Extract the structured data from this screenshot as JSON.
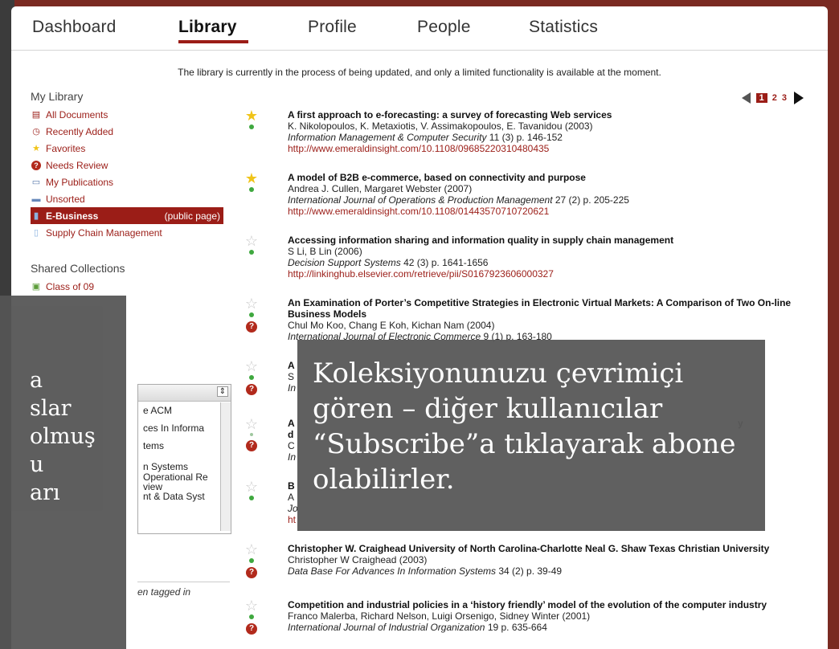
{
  "nav": {
    "tabs": [
      {
        "label": "Dashboard"
      },
      {
        "label": "Library"
      },
      {
        "label": "Profile"
      },
      {
        "label": "People"
      },
      {
        "label": "Statistics"
      }
    ],
    "active": "Library"
  },
  "notice": "The library is currently in the process of being updated, and only a limited functionality is available at the moment.",
  "sidebar": {
    "heading": "My Library",
    "items": [
      {
        "label": "All Documents",
        "icon": "documents-icon"
      },
      {
        "label": "Recently Added",
        "icon": "clock-icon"
      },
      {
        "label": "Favorites",
        "icon": "star-icon"
      },
      {
        "label": "Needs Review",
        "icon": "question-icon"
      },
      {
        "label": "My Publications",
        "icon": "id-card-icon"
      },
      {
        "label": "Unsorted",
        "icon": "tray-icon"
      },
      {
        "label": "E-Business",
        "extra": "(public page)",
        "icon": "book-icon"
      },
      {
        "label": "Supply Chain Management",
        "icon": "book-icon"
      }
    ],
    "shared_heading": "Shared Collections",
    "shared_items": [
      {
        "label": "Class of 09"
      }
    ]
  },
  "pager": {
    "current": "1",
    "pages": [
      "2",
      "3"
    ]
  },
  "documents": [
    {
      "title": "A first approach to e-forecasting: a survey of forecasting Web services",
      "authors": "K. Nikolopoulos, K. Metaxiotis, V. Assimakopoulos, E. Tavanidou (2003)",
      "journal": "Information Management & Computer Security",
      "details": " 11 (3) p. 146-152",
      "link": "http://www.emeraldinsight.com/10.1108/09685220310480435"
    },
    {
      "title": "A model of B2B e-commerce, based on connectivity and purpose",
      "authors": "Andrea J. Cullen, Margaret Webster (2007)",
      "journal": "International Journal of Operations & Production Management",
      "details": " 27 (2) p. 205-225",
      "link": "http://www.emeraldinsight.com/10.1108/01443570710720621"
    },
    {
      "title": "Accessing information sharing and information quality in supply chain management",
      "authors": "S Li, B Lin (2006)",
      "journal": "Decision Support Systems",
      "details": " 42 (3) p. 1641-1656",
      "link": "http://linkinghub.elsevier.com/retrieve/pii/S0167923606000327"
    },
    {
      "title": "An Examination of Porter’s Competitive Strategies in Electronic Virtual Markets: A Comparison of Two On-line Business Models",
      "authors": "Chul Mo Koo, Chang E Koh, Kichan Nam (2004)",
      "journal": "International Journal of Electronic Commerce",
      "details": " 9 (1) p. 163-180"
    },
    {
      "title": "A",
      "authors": "S",
      "journal": "In"
    },
    {
      "title": "A",
      "title_tail": "y",
      "title2": "d",
      "authors": "C",
      "journal": "In"
    },
    {
      "title": "B",
      "authors": "A",
      "journal": "Jo",
      "link": "ht"
    },
    {
      "title": "Christopher W. Craighead University of North Carolina-Charlotte Neal G. Shaw Texas Christian University",
      "authors": "Christopher W Craighead (2003)",
      "journal": "Data Base For Advances In Information Systems",
      "details": " 34 (2) p. 39-49"
    },
    {
      "title": "Competition and industrial policies in a ‘history friendly’ model of the evolution of the computer industry",
      "authors": "Franco Malerba, Richard Nelson, Luigi Orsenigo, Sidney Winter (2001)",
      "journal": "International Journal of Industrial Organization",
      "details": " 19 p. 635-664"
    }
  ],
  "listbox": {
    "rows": [
      "e ACM",
      "ces In Informa",
      "tems",
      "n Systems",
      "Operational Re",
      "view",
      "nt & Data Syst"
    ]
  },
  "tagged_text": "en tagged in",
  "overlay_left": {
    "lines": [
      "a",
      "slar",
      "olmuş",
      "u",
      "arı"
    ]
  },
  "overlay_right": {
    "text": "Koleksiyonunuzu çevrimiçi gören – diğer kullanıcılar “Subscribe”a tıklayarak abone olabilirler."
  },
  "colors": {
    "accent": "#9b1d17",
    "background": "#7a2a22",
    "favorite_star": "#f0c419",
    "status_dot": "#3fa83f"
  }
}
